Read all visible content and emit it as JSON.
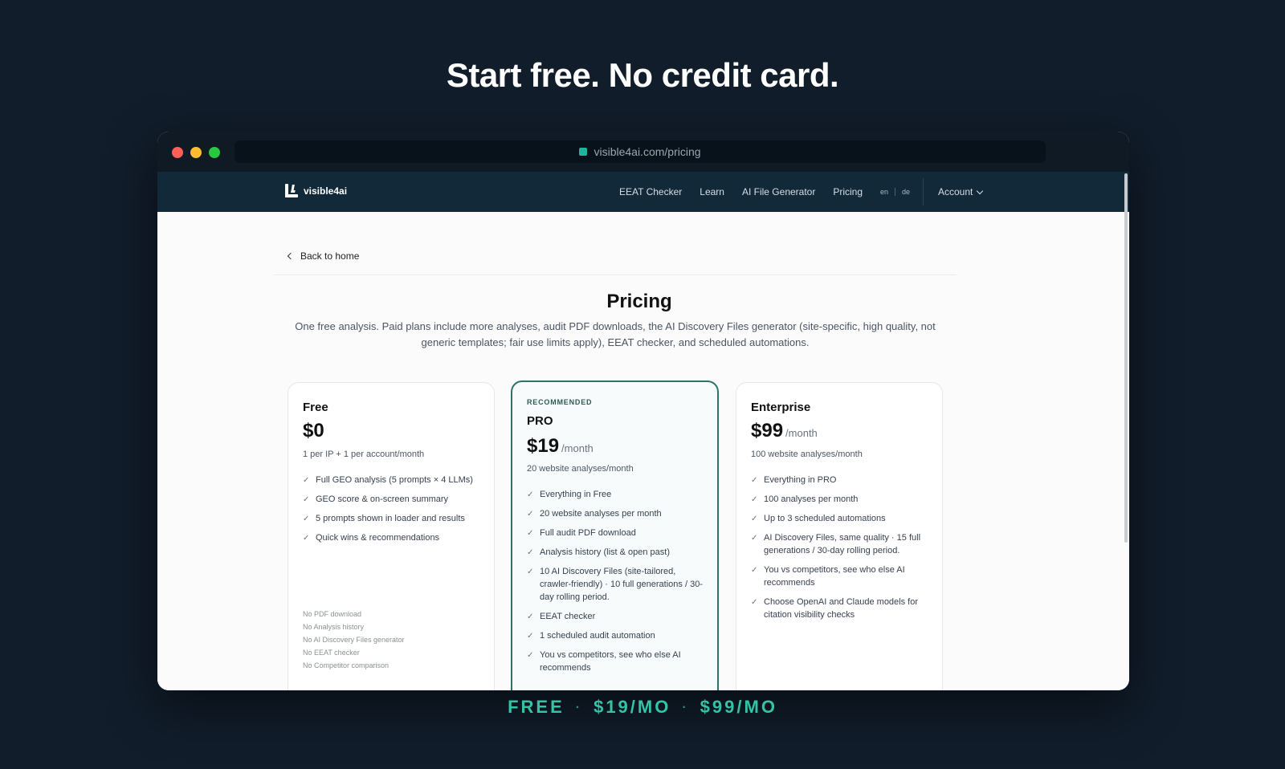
{
  "headline": "Start free. No credit card.",
  "browser": {
    "url": "visible4ai.com/pricing",
    "accent_color": "#22b39a"
  },
  "nav": {
    "logo_text": "visible4ai",
    "links": [
      "EEAT Checker",
      "Learn",
      "AI File Generator",
      "Pricing"
    ],
    "lang_en": "en",
    "lang_de": "de",
    "account_label": "Account"
  },
  "page": {
    "back_label": "Back to home",
    "title": "Pricing",
    "description": "One free analysis. Paid plans include more analyses, audit PDF downloads, the AI Discovery Files generator (site-specific, high quality, not generic templates; fair use limits apply), EEAT checker, and scheduled automations."
  },
  "plans": {
    "free": {
      "name": "Free",
      "price": "$0",
      "subtitle": "1 per IP + 1 per account/month",
      "features": [
        "Full GEO analysis (5 prompts × 4 LLMs)",
        "GEO score & on-screen summary",
        "5 prompts shown in loader and results",
        "Quick wins & recommendations"
      ],
      "excluded": [
        "No PDF download",
        "No Analysis history",
        "No AI Discovery Files generator",
        "No EEAT checker",
        "No Competitor comparison"
      ]
    },
    "pro": {
      "badge": "RECOMMENDED",
      "name": "PRO",
      "price": "$19",
      "period": "/month",
      "subtitle": "20 website analyses/month",
      "features": [
        "Everything in Free",
        "20 website analyses per month",
        "Full audit PDF download",
        "Analysis history (list & open past)",
        "10 AI Discovery Files (site-tailored, crawler-friendly) · 10 full generations / 30-day rolling period.",
        "EEAT checker",
        "1 scheduled audit automation",
        "You vs competitors, see who else AI recommends"
      ],
      "border_color": "#2f7268"
    },
    "enterprise": {
      "name": "Enterprise",
      "price": "$99",
      "period": "/month",
      "subtitle": "100 website analyses/month",
      "features": [
        "Everything in PRO",
        "100 analyses per month",
        "Up to 3 scheduled automations",
        "AI Discovery Files, same quality · 15 full generations / 30-day rolling period.",
        "You vs competitors, see who else AI recommends",
        "Choose OpenAI and Claude models for citation visibility checks"
      ]
    }
  },
  "footer": {
    "free": "FREE",
    "pro": "$19/MO",
    "enterprise": "$99/MO",
    "separator": "·",
    "color": "#34c3a6"
  }
}
